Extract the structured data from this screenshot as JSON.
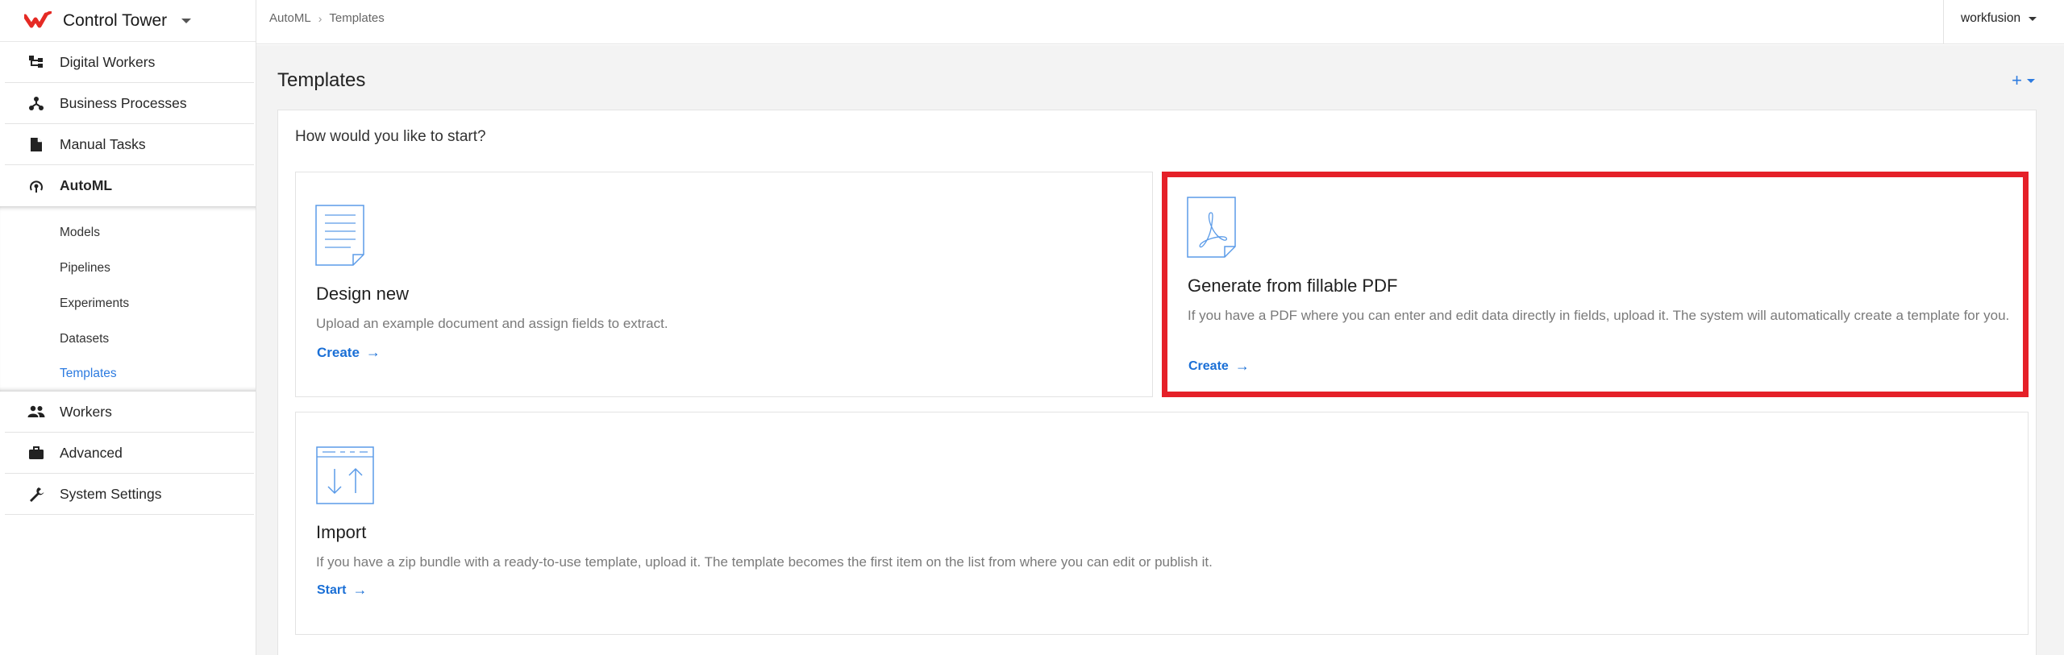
{
  "app": {
    "title": "Control Tower",
    "logo_icon": "workfusion-logo-icon"
  },
  "sidebar": {
    "items": [
      {
        "label": "Digital Workers",
        "icon": "hierarchy-icon"
      },
      {
        "label": "Business Processes",
        "icon": "process-tree-icon"
      },
      {
        "label": "Manual Tasks",
        "icon": "document-icon"
      },
      {
        "label": "AutoML",
        "icon": "automl-icon",
        "active": true
      }
    ],
    "submenu": [
      {
        "label": "Models"
      },
      {
        "label": "Pipelines"
      },
      {
        "label": "Experiments"
      },
      {
        "label": "Datasets"
      },
      {
        "label": "Templates",
        "active": true
      }
    ],
    "items_after": [
      {
        "label": "Workers",
        "icon": "people-icon"
      },
      {
        "label": "Advanced",
        "icon": "briefcase-icon"
      },
      {
        "label": "System Settings",
        "icon": "wrench-icon"
      }
    ]
  },
  "topbar": {
    "breadcrumb": [
      "AutoML",
      "Templates"
    ],
    "user": "workfusion"
  },
  "main": {
    "title": "Templates",
    "add_label": "+",
    "question": "How would you like to start?",
    "cards": {
      "design": {
        "title": "Design new",
        "description": "Upload an example document and assign fields to extract.",
        "link": "Create"
      },
      "pdf": {
        "title": "Generate from fillable PDF",
        "description": "If you have a PDF where you can enter and edit data directly in fields, upload it. The system will automatically create a template for you.",
        "link": "Create"
      },
      "import": {
        "title": "Import",
        "description": "If you have a zip bundle with a ready-to-use template, upload it. The template becomes the first item on the list from where you can edit or publish it.",
        "link": "Start"
      }
    }
  },
  "colors": {
    "accent": "#2d7be0",
    "link": "#1a6fd6",
    "highlight": "#e52028",
    "brand": "#e52a24",
    "icon_stroke": "#5b9be8"
  }
}
